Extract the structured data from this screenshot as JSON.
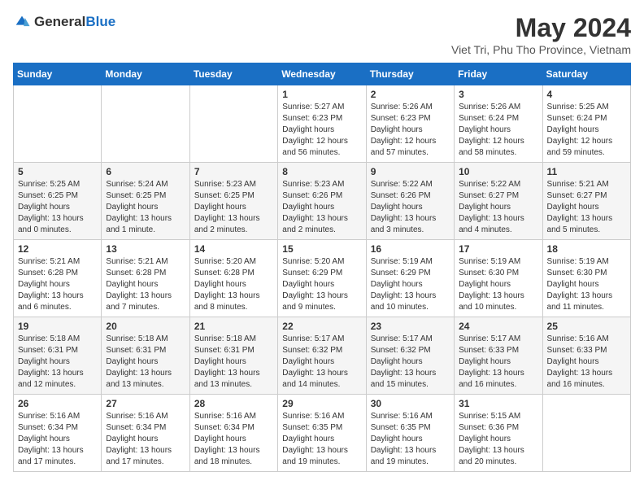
{
  "logo": {
    "general": "General",
    "blue": "Blue"
  },
  "title": {
    "month_year": "May 2024",
    "location": "Viet Tri, Phu Tho Province, Vietnam"
  },
  "days_of_week": [
    "Sunday",
    "Monday",
    "Tuesday",
    "Wednesday",
    "Thursday",
    "Friday",
    "Saturday"
  ],
  "weeks": [
    [
      {
        "day": "",
        "sunrise": "",
        "sunset": "",
        "daylight": ""
      },
      {
        "day": "",
        "sunrise": "",
        "sunset": "",
        "daylight": ""
      },
      {
        "day": "",
        "sunrise": "",
        "sunset": "",
        "daylight": ""
      },
      {
        "day": "1",
        "sunrise": "5:27 AM",
        "sunset": "6:23 PM",
        "daylight": "12 hours and 56 minutes."
      },
      {
        "day": "2",
        "sunrise": "5:26 AM",
        "sunset": "6:23 PM",
        "daylight": "12 hours and 57 minutes."
      },
      {
        "day": "3",
        "sunrise": "5:26 AM",
        "sunset": "6:24 PM",
        "daylight": "12 hours and 58 minutes."
      },
      {
        "day": "4",
        "sunrise": "5:25 AM",
        "sunset": "6:24 PM",
        "daylight": "12 hours and 59 minutes."
      }
    ],
    [
      {
        "day": "5",
        "sunrise": "5:25 AM",
        "sunset": "6:25 PM",
        "daylight": "13 hours and 0 minutes."
      },
      {
        "day": "6",
        "sunrise": "5:24 AM",
        "sunset": "6:25 PM",
        "daylight": "13 hours and 1 minute."
      },
      {
        "day": "7",
        "sunrise": "5:23 AM",
        "sunset": "6:25 PM",
        "daylight": "13 hours and 2 minutes."
      },
      {
        "day": "8",
        "sunrise": "5:23 AM",
        "sunset": "6:26 PM",
        "daylight": "13 hours and 2 minutes."
      },
      {
        "day": "9",
        "sunrise": "5:22 AM",
        "sunset": "6:26 PM",
        "daylight": "13 hours and 3 minutes."
      },
      {
        "day": "10",
        "sunrise": "5:22 AM",
        "sunset": "6:27 PM",
        "daylight": "13 hours and 4 minutes."
      },
      {
        "day": "11",
        "sunrise": "5:21 AM",
        "sunset": "6:27 PM",
        "daylight": "13 hours and 5 minutes."
      }
    ],
    [
      {
        "day": "12",
        "sunrise": "5:21 AM",
        "sunset": "6:28 PM",
        "daylight": "13 hours and 6 minutes."
      },
      {
        "day": "13",
        "sunrise": "5:21 AM",
        "sunset": "6:28 PM",
        "daylight": "13 hours and 7 minutes."
      },
      {
        "day": "14",
        "sunrise": "5:20 AM",
        "sunset": "6:28 PM",
        "daylight": "13 hours and 8 minutes."
      },
      {
        "day": "15",
        "sunrise": "5:20 AM",
        "sunset": "6:29 PM",
        "daylight": "13 hours and 9 minutes."
      },
      {
        "day": "16",
        "sunrise": "5:19 AM",
        "sunset": "6:29 PM",
        "daylight": "13 hours and 10 minutes."
      },
      {
        "day": "17",
        "sunrise": "5:19 AM",
        "sunset": "6:30 PM",
        "daylight": "13 hours and 10 minutes."
      },
      {
        "day": "18",
        "sunrise": "5:19 AM",
        "sunset": "6:30 PM",
        "daylight": "13 hours and 11 minutes."
      }
    ],
    [
      {
        "day": "19",
        "sunrise": "5:18 AM",
        "sunset": "6:31 PM",
        "daylight": "13 hours and 12 minutes."
      },
      {
        "day": "20",
        "sunrise": "5:18 AM",
        "sunset": "6:31 PM",
        "daylight": "13 hours and 13 minutes."
      },
      {
        "day": "21",
        "sunrise": "5:18 AM",
        "sunset": "6:31 PM",
        "daylight": "13 hours and 13 minutes."
      },
      {
        "day": "22",
        "sunrise": "5:17 AM",
        "sunset": "6:32 PM",
        "daylight": "13 hours and 14 minutes."
      },
      {
        "day": "23",
        "sunrise": "5:17 AM",
        "sunset": "6:32 PM",
        "daylight": "13 hours and 15 minutes."
      },
      {
        "day": "24",
        "sunrise": "5:17 AM",
        "sunset": "6:33 PM",
        "daylight": "13 hours and 16 minutes."
      },
      {
        "day": "25",
        "sunrise": "5:16 AM",
        "sunset": "6:33 PM",
        "daylight": "13 hours and 16 minutes."
      }
    ],
    [
      {
        "day": "26",
        "sunrise": "5:16 AM",
        "sunset": "6:34 PM",
        "daylight": "13 hours and 17 minutes."
      },
      {
        "day": "27",
        "sunrise": "5:16 AM",
        "sunset": "6:34 PM",
        "daylight": "13 hours and 17 minutes."
      },
      {
        "day": "28",
        "sunrise": "5:16 AM",
        "sunset": "6:34 PM",
        "daylight": "13 hours and 18 minutes."
      },
      {
        "day": "29",
        "sunrise": "5:16 AM",
        "sunset": "6:35 PM",
        "daylight": "13 hours and 19 minutes."
      },
      {
        "day": "30",
        "sunrise": "5:16 AM",
        "sunset": "6:35 PM",
        "daylight": "13 hours and 19 minutes."
      },
      {
        "day": "31",
        "sunrise": "5:15 AM",
        "sunset": "6:36 PM",
        "daylight": "13 hours and 20 minutes."
      },
      {
        "day": "",
        "sunrise": "",
        "sunset": "",
        "daylight": ""
      }
    ]
  ]
}
